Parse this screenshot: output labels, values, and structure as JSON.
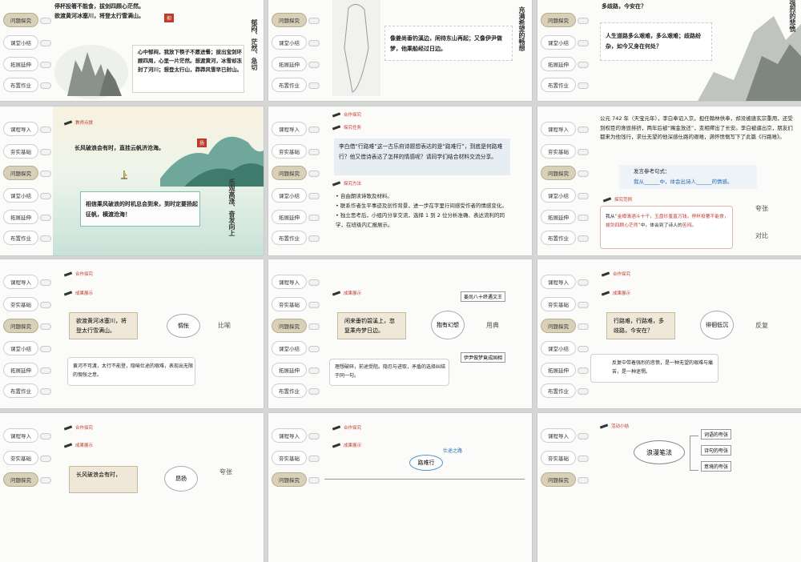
{
  "nav": [
    "课程导入",
    "夯实基础",
    "问题探究",
    "课堂小结",
    "拓展延伸",
    "布置作业"
  ],
  "nav_top": [
    "问题探究",
    "课堂小结",
    "拓展延伸",
    "布置作业"
  ],
  "s1": {
    "line1": "停杯投箸不能食，拔剑四顾心茫然。",
    "line2": "欲渡黄河冰塞川，将登太行雪满山。",
    "seal": "抑",
    "vert": "郁闷、茫然、急切",
    "para": "心中郁闷，我放下筷子不愿进餐；拔出宝剑环顾四周，心里一片茫然。想渡黄河，冰雪却冻封了河川；想登太行山，莽莽风雪早已封山。"
  },
  "s2": {
    "quote": "像姜尚垂钓溪边，闲待东山再起；又像伊尹做梦，他乘船经过日边。",
    "vert": "充满希望的畅想"
  },
  "s3": {
    "top": "多歧路，今安在？",
    "quote": "人生道路多么艰难，多么艰难；歧路纷杂，如今又身在何处？",
    "vert": "强烈的悲愤"
  },
  "s4": {
    "tag": "教师点拨",
    "line1": "长风破浪会有时，直挂云帆济沧海。",
    "seal": "扬",
    "quote": "相信乘风破浪的时机总会到来，到时定要扬起征帆，横渡沧海！",
    "vert": "乐观高涨、奋发向上"
  },
  "s5": {
    "tag1": "合作探究",
    "tag2": "探究任务",
    "task": "李白借“行路难”这一古乐府诗题想表达的是“路难行”，到底是何路难行？他又借诗表达了怎样的情感呢？请同学们结合材料交流分享。",
    "tag3": "探究方法",
    "methods": [
      "自由朗读诗歌及材料。",
      "联系作者生平事迹及创作背景，进一步在字里行间感受作者的情感变化。",
      "独立思考后，小组内分享交流，选择 1 到 2 位分析准确、表达流利的同学，在班级内汇报展示。"
    ]
  },
  "s6": {
    "para": "公元 742 年（天宝元年），李白奉诏入京，担任翰林供奉，却没被唐玄宗重用，还受到权臣的谗毁排挤，两年后被“赐金放还”，变相撵出了长安。李白被逼出京，朋友们都来为他饯行，求仕无望的他深感仕路的艰难，满怀愤慨写下了此篇《行路难》。",
    "ref_title": "发言参考句式：",
    "ref": "我从______中，体会出诗人______的情感。",
    "tag": "探究范例",
    "example_pre": "我从",
    "example_quote": "“金樽清酒斗十千，玉盘珍羞直万钱。停杯投箸不能食，拔剑四顾心茫然”",
    "example_mid": "中，体会到了诗人的",
    "example_end": "苦闷",
    "example_tail": "。",
    "side1": "夸张",
    "side2": "对比"
  },
  "s7": {
    "tag1": "合作探究",
    "tag2": "成果展示",
    "scroll": "欲渡黄河冰塞川，将登太行雪满山。",
    "oval": "惆怅",
    "side": "比喻",
    "note": "黄河不可渡，太行不能登，隐喻仕途的艰难，表现出无限的惆怅之意。"
  },
  "s8": {
    "box1": "姜尚八十终遇文王",
    "scroll": "闲来垂钓碧溪上，忽复乘舟梦日边。",
    "oval": "抱有幻想",
    "side": "用典",
    "box2": "伊尹做梦竟成国相",
    "note": "理想破碎，前途受阻。隐忍与进取，矛盾的选择纠结于同一句。"
  },
  "s9": {
    "tag1": "合作探究",
    "tag2": "成果展示",
    "scroll": "行路难，行路难，多歧路，今安在？",
    "oval": "徘徊低沉",
    "side": "反复",
    "note": "反复中带着强烈的悲愤，是一种无望的艰难与痛苦，是一种迷惘。"
  },
  "s10": {
    "tag1": "合作探究",
    "tag2": "成果展示",
    "scroll": "长风破浪会有时，",
    "oval": "昂扬",
    "side": "夸张"
  },
  "s11": {
    "box": "仕途之路",
    "oval": "路难行"
  },
  "s12": {
    "tag": "活动小结",
    "oval": "浪漫笔法",
    "items": [
      "词语的夸张",
      "诗句的夸张",
      "意境的夸张"
    ]
  }
}
